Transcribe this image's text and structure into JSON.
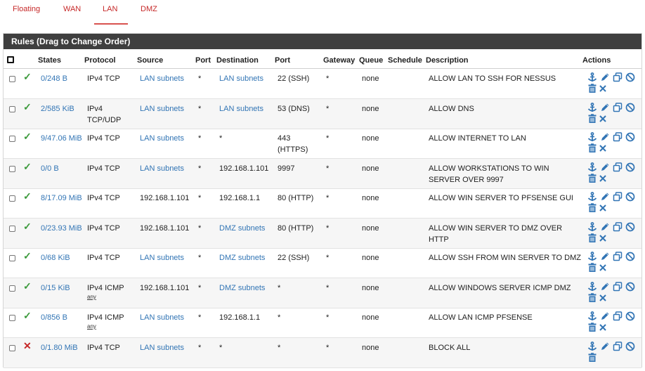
{
  "tabs": [
    {
      "label": "Floating",
      "active": false
    },
    {
      "label": "WAN",
      "active": false
    },
    {
      "label": "LAN",
      "active": true
    },
    {
      "label": "DMZ",
      "active": false
    }
  ],
  "panel": {
    "title": "Rules (Drag to Change Order)"
  },
  "columns": {
    "states": "States",
    "protocol": "Protocol",
    "source": "Source",
    "source_port": "Port",
    "destination": "Destination",
    "dest_port": "Port",
    "gateway": "Gateway",
    "queue": "Queue",
    "schedule": "Schedule",
    "description": "Description",
    "actions": "Actions"
  },
  "icons": {
    "pass": "check-icon",
    "block": "x-icon",
    "anchor": "anchor-icon",
    "edit": "pencil-icon",
    "copy": "copy-icon",
    "disable": "ban-icon",
    "delete": "trash-icon",
    "remove": "close-icon"
  },
  "colors": {
    "link": "#3275b5",
    "tab_accent": "#d9534f",
    "pass": "#3c9a3c",
    "block": "#c62828",
    "heading_bg": "#3f3f3f",
    "icon": "#3275b5"
  },
  "rules": [
    {
      "status": "pass",
      "states": "0/248 B",
      "protocol": "IPv4 TCP",
      "protocol_sub": "",
      "source": "LAN subnets",
      "source_link": true,
      "source_port": "*",
      "destination": "LAN subnets",
      "destination_link": true,
      "dest_port": "22 (SSH)",
      "gateway": "*",
      "queue": "none",
      "schedule": "",
      "description": "ALLOW LAN TO SSH FOR NESSUS",
      "has_remove": true
    },
    {
      "status": "pass",
      "states": "2/585 KiB",
      "protocol": "IPv4 TCP/UDP",
      "protocol_sub": "",
      "source": "LAN subnets",
      "source_link": true,
      "source_port": "*",
      "destination": "LAN subnets",
      "destination_link": true,
      "dest_port": "53 (DNS)",
      "gateway": "*",
      "queue": "none",
      "schedule": "",
      "description": "ALLOW DNS",
      "has_remove": true
    },
    {
      "status": "pass",
      "states": "9/47.06 MiB",
      "protocol": "IPv4 TCP",
      "protocol_sub": "",
      "source": "LAN subnets",
      "source_link": true,
      "source_port": "*",
      "destination": "*",
      "destination_link": false,
      "dest_port": "443 (HTTPS)",
      "gateway": "*",
      "queue": "none",
      "schedule": "",
      "description": "ALLOW INTERNET TO LAN",
      "has_remove": true
    },
    {
      "status": "pass",
      "states": "0/0 B",
      "protocol": "IPv4 TCP",
      "protocol_sub": "",
      "source": "LAN subnets",
      "source_link": true,
      "source_port": "*",
      "destination": "192.168.1.101",
      "destination_link": false,
      "dest_port": "9997",
      "gateway": "*",
      "queue": "none",
      "schedule": "",
      "description": "ALLOW WORKSTATIONS TO WIN SERVER OVER 9997",
      "has_remove": true
    },
    {
      "status": "pass",
      "states": "8/17.09 MiB",
      "protocol": "IPv4 TCP",
      "protocol_sub": "",
      "source": "192.168.1.101",
      "source_link": false,
      "source_port": "*",
      "destination": "192.168.1.1",
      "destination_link": false,
      "dest_port": "80 (HTTP)",
      "gateway": "*",
      "queue": "none",
      "schedule": "",
      "description": "ALLOW WIN SERVER TO PFSENSE GUI",
      "has_remove": true
    },
    {
      "status": "pass",
      "states": "0/23.93 MiB",
      "protocol": "IPv4 TCP",
      "protocol_sub": "",
      "source": "192.168.1.101",
      "source_link": false,
      "source_port": "*",
      "destination": "DMZ subnets",
      "destination_link": true,
      "dest_port": "80 (HTTP)",
      "gateway": "*",
      "queue": "none",
      "schedule": "",
      "description": "ALLOW WIN SERVER TO DMZ OVER HTTP",
      "has_remove": true
    },
    {
      "status": "pass",
      "states": "0/68 KiB",
      "protocol": "IPv4 TCP",
      "protocol_sub": "",
      "source": "LAN subnets",
      "source_link": true,
      "source_port": "*",
      "destination": "DMZ subnets",
      "destination_link": true,
      "dest_port": "22 (SSH)",
      "gateway": "*",
      "queue": "none",
      "schedule": "",
      "description": "ALLOW SSH FROM WIN SERVER TO DMZ",
      "has_remove": true
    },
    {
      "status": "pass",
      "states": "0/15 KiB",
      "protocol": "IPv4 ICMP",
      "protocol_sub": "any",
      "source": "192.168.1.101",
      "source_link": false,
      "source_port": "*",
      "destination": "DMZ subnets",
      "destination_link": true,
      "dest_port": "*",
      "gateway": "*",
      "queue": "none",
      "schedule": "",
      "description": "ALLOW WINDOWS SERVER ICMP DMZ",
      "has_remove": true
    },
    {
      "status": "pass",
      "states": "0/856 B",
      "protocol": "IPv4 ICMP",
      "protocol_sub": "any",
      "source": "LAN subnets",
      "source_link": true,
      "source_port": "*",
      "destination": "192.168.1.1",
      "destination_link": false,
      "dest_port": "*",
      "gateway": "*",
      "queue": "none",
      "schedule": "",
      "description": "ALLOW LAN ICMP PFSENSE",
      "has_remove": true
    },
    {
      "status": "block",
      "states": "0/1.80 MiB",
      "protocol": "IPv4 TCP",
      "protocol_sub": "",
      "source": "LAN subnets",
      "source_link": true,
      "source_port": "*",
      "destination": "*",
      "destination_link": false,
      "dest_port": "*",
      "gateway": "*",
      "queue": "none",
      "schedule": "",
      "description": "BLOCK ALL",
      "has_remove": false
    }
  ]
}
